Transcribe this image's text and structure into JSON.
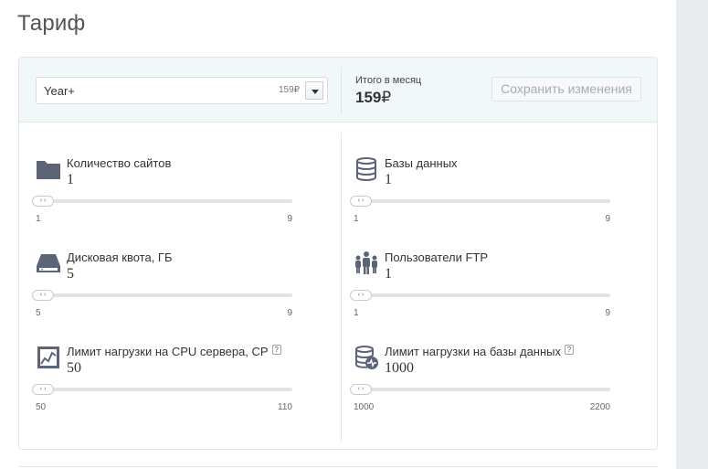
{
  "page": {
    "title": "Тариф"
  },
  "tariff": {
    "selected_name": "Year+",
    "selected_price": "159₽"
  },
  "total": {
    "label": "Итого в месяц",
    "value": "159",
    "currency": "₽"
  },
  "save_button": {
    "label": "Сохранить изменения"
  },
  "params": [
    {
      "id": "sites",
      "label": "Количество сайтов",
      "value": "1",
      "min": "1",
      "max": "9",
      "level": 0,
      "icon": "folder-icon",
      "help": false
    },
    {
      "id": "databases",
      "label": "Базы данных",
      "value": "1",
      "min": "1",
      "max": "9",
      "level": 0,
      "icon": "database-icon",
      "help": false
    },
    {
      "id": "disk",
      "label": "Дисковая квота, ГБ",
      "value": "5",
      "min": "5",
      "max": "9",
      "level": 0,
      "icon": "hard-drive-icon",
      "help": false
    },
    {
      "id": "ftp",
      "label": "Пользователи FTP",
      "value": "1",
      "min": "1",
      "max": "9",
      "level": 0,
      "icon": "users-icon",
      "help": false
    },
    {
      "id": "cpu",
      "label": "Лимит нагрузки на CPU сервера, CP",
      "value": "50",
      "min": "50",
      "max": "110",
      "level": 0,
      "icon": "cpu-icon",
      "help": true,
      "help_label": "?"
    },
    {
      "id": "db_load",
      "label": "Лимит нагрузки на базы данных",
      "value": "1000",
      "min": "1000",
      "max": "2200",
      "level": 0,
      "icon": "database-load-icon",
      "help": true,
      "help_label": "?"
    }
  ],
  "colors": {
    "header_bg": "#f1f8fa",
    "icon": "#5c6478",
    "rail": "#e9ecee"
  }
}
